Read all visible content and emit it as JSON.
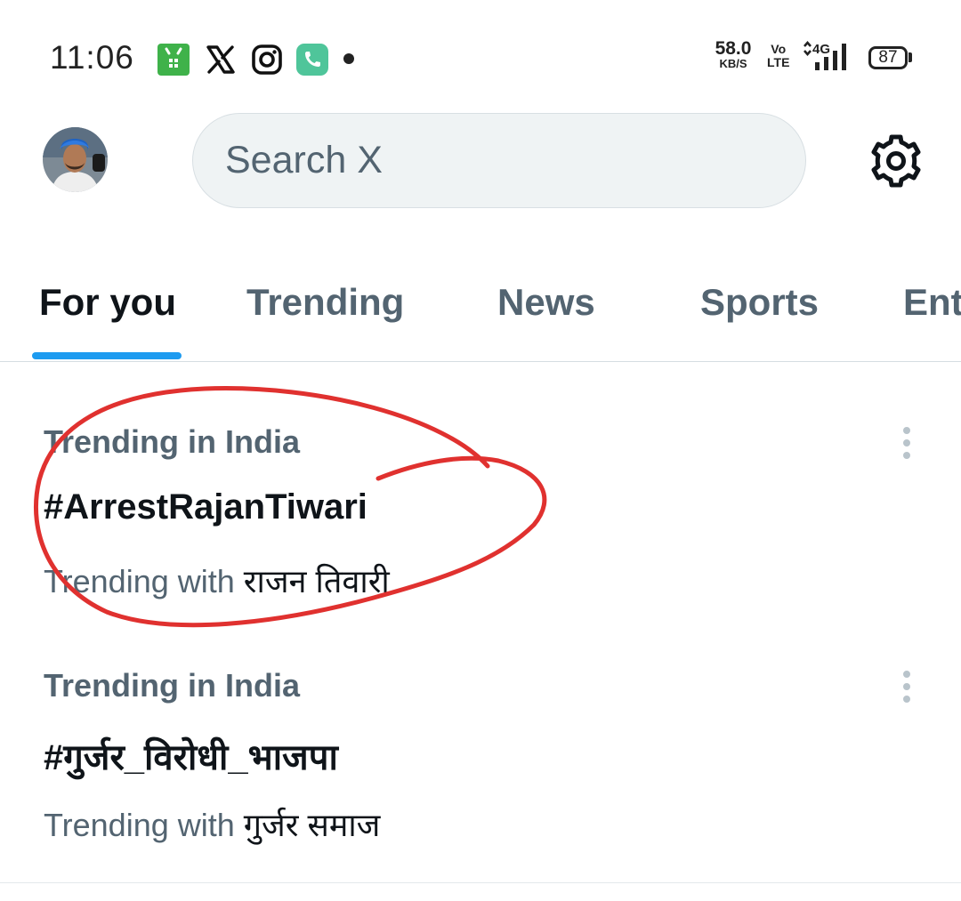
{
  "status_bar": {
    "time": "11:06",
    "net_speed_value": "58.0",
    "net_speed_unit": "KB/S",
    "volte_top": "Vo",
    "volte_bottom": "LTE",
    "network_type": "4G",
    "battery": "87",
    "notification_icons": [
      "app-store-icon",
      "x-icon",
      "instagram-icon",
      "phone-icon"
    ]
  },
  "header": {
    "search_placeholder": "Search X"
  },
  "tabs": [
    {
      "label": "For you",
      "active": true
    },
    {
      "label": "Trending",
      "active": false
    },
    {
      "label": "News",
      "active": false
    },
    {
      "label": "Sports",
      "active": false
    },
    {
      "label": "Ent",
      "active": false
    }
  ],
  "trends": [
    {
      "context": "Trending in India",
      "name": "#ArrestRajanTiwari",
      "with_prefix": "Trending with ",
      "with_term": "राजन तिवारी"
    },
    {
      "context": "Trending in India",
      "name": "#गुर्जर_विरोधी_भाजपा",
      "with_prefix": "Trending with ",
      "with_term": "गुर्जर समाज"
    }
  ],
  "colors": {
    "accent": "#1d9bf0",
    "annotation": "#e0312f",
    "secondary_text": "#536471",
    "primary_text": "#0f1419"
  }
}
